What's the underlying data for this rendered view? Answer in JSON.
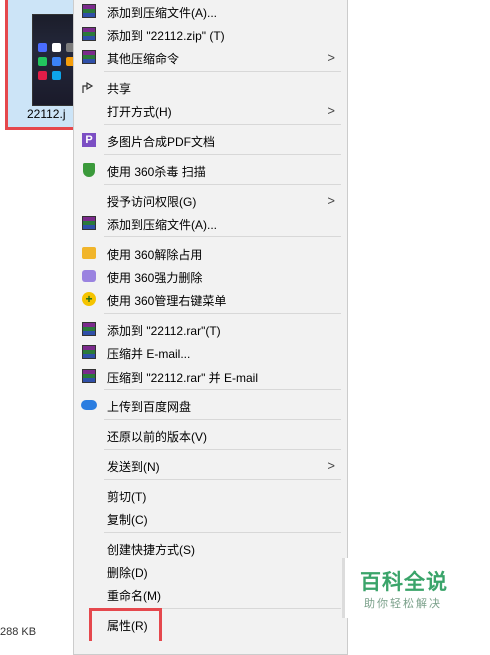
{
  "file": {
    "name": "22112.j",
    "size_text": "288 KB"
  },
  "menu": {
    "items": [
      {
        "label": "添加到压缩文件(A)...",
        "icon": "winrar-icon",
        "arrow": false
      },
      {
        "label": "添加到 \"22112.zip\" (T)",
        "icon": "winrar-icon",
        "arrow": false
      },
      {
        "label": "其他压缩命令",
        "icon": "winrar-icon",
        "arrow": true
      },
      {
        "label": "共享",
        "icon": "share-icon",
        "arrow": false
      },
      {
        "label": "打开方式(H)",
        "icon": "",
        "arrow": true
      },
      {
        "label": "多图片合成PDF文档",
        "icon": "pdf-icon",
        "arrow": false
      },
      {
        "label": "使用 360杀毒 扫描",
        "icon": "shield-icon",
        "arrow": false
      },
      {
        "label": "授予访问权限(G)",
        "icon": "",
        "arrow": true
      },
      {
        "label": "添加到压缩文件(A)...",
        "icon": "winrar-icon",
        "arrow": false
      },
      {
        "label": "使用 360解除占用",
        "icon": "unlock-icon",
        "arrow": false
      },
      {
        "label": "使用 360强力删除",
        "icon": "delete-icon",
        "arrow": false
      },
      {
        "label": "使用 360管理右键菜单",
        "icon": "menu-manage-icon",
        "arrow": false
      },
      {
        "label": "添加到 \"22112.rar\"(T)",
        "icon": "winrar-icon",
        "arrow": false
      },
      {
        "label": "压缩并 E-mail...",
        "icon": "winrar-icon",
        "arrow": false
      },
      {
        "label": "压缩到 \"22112.rar\" 并 E-mail",
        "icon": "winrar-icon",
        "arrow": false
      },
      {
        "label": "上传到百度网盘",
        "icon": "cloud-icon",
        "arrow": false
      },
      {
        "label": "还原以前的版本(V)",
        "icon": "",
        "arrow": false
      },
      {
        "label": "发送到(N)",
        "icon": "",
        "arrow": true
      },
      {
        "label": "剪切(T)",
        "icon": "",
        "arrow": false
      },
      {
        "label": "复制(C)",
        "icon": "",
        "arrow": false
      },
      {
        "label": "创建快捷方式(S)",
        "icon": "",
        "arrow": false
      },
      {
        "label": "删除(D)",
        "icon": "",
        "arrow": false
      },
      {
        "label": "重命名(M)",
        "icon": "",
        "arrow": false
      },
      {
        "label": "属性(R)",
        "icon": "",
        "arrow": false
      }
    ]
  },
  "watermark": {
    "title": "百科全说",
    "subtitle": "助你轻松解决"
  },
  "colors": {
    "highlight": "#e5484d",
    "menu_bg": "#f2f2f2",
    "watermark": "#3aa46a"
  }
}
